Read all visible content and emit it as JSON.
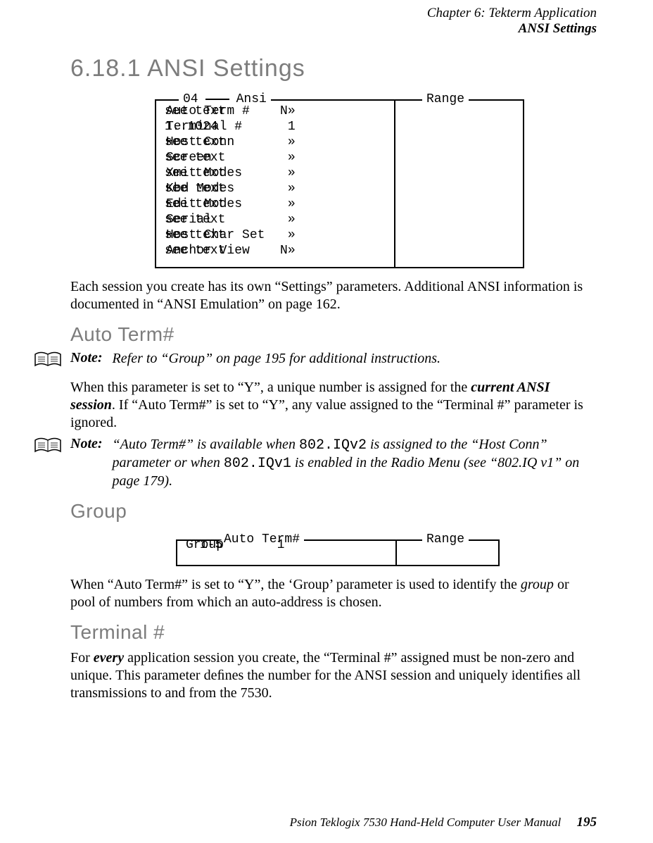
{
  "header": {
    "chapter": "Chapter 6: Tekterm Application",
    "section": "ANSI Settings"
  },
  "title": "6.18.1  ANSI Settings",
  "box1": {
    "leg_num": "04",
    "leg_main": "Ansi",
    "leg_side": "Range",
    "rows": [
      {
        "name": "Auto Term #",
        "val": "N»",
        "range": "see text"
      },
      {
        "name": "Terminal #",
        "val": "1",
        "range": "1..1024"
      },
      {
        "name": "Host Conn",
        "val": "»",
        "range": "see text"
      },
      {
        "name": "Screen",
        "val": "»",
        "range": "see text"
      },
      {
        "name": "Xmit Modes",
        "val": "»",
        "range": "see text"
      },
      {
        "name": "Kbd Modes",
        "val": "»",
        "range": "see text"
      },
      {
        "name": "Edit Modes",
        "val": "»",
        "range": "see text"
      },
      {
        "name": "Serial",
        "val": "»",
        "range": "see text"
      },
      {
        "name": "Host Char Set",
        "val": "»",
        "range": "see text"
      },
      {
        "name": "Anchor View",
        "val": "N»",
        "range": "see text"
      }
    ]
  },
  "p1": "Each session you create has its own “Settings” parameters. Additional ANSI information is documented in “ANSI Emulation” on page 162.",
  "h_autoterm": "Auto Term#",
  "note1_label": "Note:",
  "note1_text": "Refer to “Group” on page 195 for additional instructions.",
  "p2_a": "When this parameter is set to “Y”, a unique number is assigned for the ",
  "p2_b": "current ANSI session",
  "p2_c": ". If “Auto Term#” is set to “Y”, any value assigned to the “Terminal #” parameter is ignored.",
  "note2_label": "Note:",
  "note2_a": "“Auto Term#” is available when ",
  "note2_code1": "802.IQv2",
  "note2_b": " is assigned to the “Host Conn” parameter or when ",
  "note2_code2": "802.IQv1",
  "note2_c": " is enabled in the Radio Menu (see “802.IQ v1” on page 179).",
  "h_group": "Group",
  "box2": {
    "leg_main": "Auto Term#",
    "leg_side": "Range",
    "row": {
      "name": "Group",
      "val": "1",
      "range": "1-5"
    }
  },
  "p3_a": "When “Auto Term#” is set to “Y”, the ‘Group’ parameter is used to identify the ",
  "p3_b": "group",
  "p3_c": " or pool of numbers from which an auto-address is chosen.",
  "h_terminal": "Terminal #",
  "p4_a": "For ",
  "p4_b": "every",
  "p4_c": " application session you create, the “Terminal #” assigned must be non-zero and unique. This parameter deﬁnes the number for the ANSI session and uniquely identiﬁes all transmissions to and from the 7530.",
  "footer": {
    "doc": "Psion Teklogix 7530 Hand-Held Computer User Manual",
    "page": "195"
  }
}
